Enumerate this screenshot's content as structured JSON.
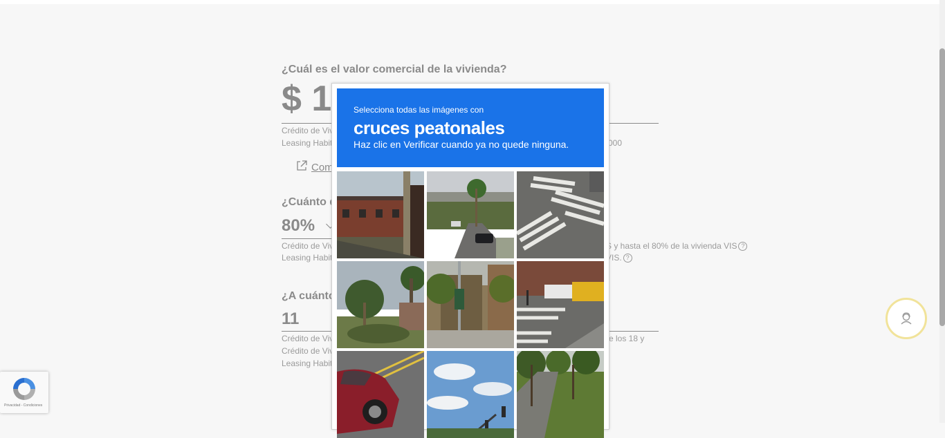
{
  "form": {
    "q1": "¿Cuál es el valor comercial de la vivienda?",
    "q1_value": "$ 1",
    "q1_note1": "Crédito de Viv",
    "q1_note2": "Leasing Habit",
    "q1_note2_tail": "000",
    "q1_link": "Com",
    "q2": "¿Cuánto d",
    "q2_value": "80%",
    "q2_note1": "Crédito de Viv",
    "q2_note1_tail": "S y hasta el 80% de la vivienda VIS",
    "q2_note2": "Leasing Habit",
    "q2_note2_tail": "VIS.",
    "q3": "¿A cuánto",
    "q3_value": "11",
    "q3_note1": "Crédito de Viv",
    "q3_note1_tail": "re los 18 y",
    "q3_note2": "Crédito de Viv",
    "q3_note3": "Leasing Habit",
    "help_mark": "?"
  },
  "captcha": {
    "instruction": "Selecciona todas las imágenes con",
    "target": "cruces peatonales",
    "hint": "Haz clic en Verificar cuando ya no quede ninguna.",
    "tiles": [
      "brick-houses",
      "palm-street",
      "crosswalk-intersection",
      "palm-garden",
      "city-building",
      "crosswalk-school-bus",
      "red-car",
      "sky-traffic-light",
      "tree-lined-road"
    ]
  },
  "recaptcha_badge": {
    "text": "Privacidad - Condiciones"
  },
  "colors": {
    "accent": "#1a73e8",
    "fab_ring": "#f1e39a",
    "text_gray": "#8a8a8a"
  },
  "icons": {
    "fab": "support-agent-icon",
    "link": "external-link-icon",
    "badge": "recaptcha-logo-icon"
  }
}
